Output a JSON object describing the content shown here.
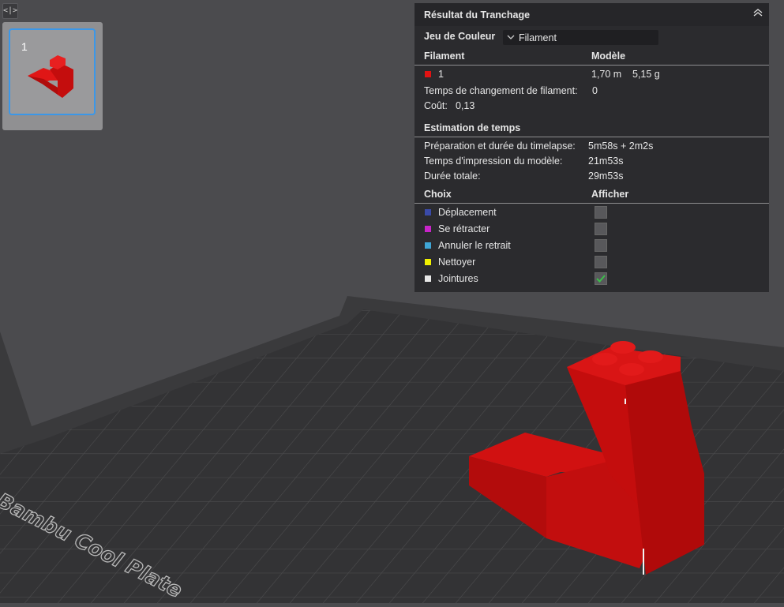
{
  "sidebar_toggle_label": "<|>",
  "plate_thumb": {
    "number": "1"
  },
  "result": {
    "title": "Résultat du Tranchage",
    "color_scheme_label": "Jeu de Couleur",
    "color_scheme_value": "Filament",
    "filament_header": "Filament",
    "model_header": "Modèle",
    "filament_rows": [
      {
        "swatch_color": "#e21212",
        "name": "1",
        "length": "1,70 m",
        "weight": "5,15 g"
      }
    ],
    "filament_change_label": "Temps de changement de filament:",
    "filament_change_value": "0",
    "cost_label": "Coût:",
    "cost_value": "0,13",
    "time_estimation_title": "Estimation de temps",
    "time_rows": [
      {
        "label": "Préparation et durée du timelapse:",
        "value": "5m58s + 2m2s"
      },
      {
        "label": "Temps d'impression du modèle:",
        "value": "21m53s"
      },
      {
        "label": "Durée totale:",
        "value": "29m53s"
      }
    ],
    "choice_header": "Choix",
    "show_header": "Afficher",
    "options": [
      {
        "label": "Déplacement",
        "color": "#3a4aa8",
        "checked": false
      },
      {
        "label": "Se rétracter",
        "color": "#c824c8",
        "checked": false
      },
      {
        "label": "Annuler le retrait",
        "color": "#3fa6d6",
        "checked": false
      },
      {
        "label": "Nettoyer",
        "color": "#f0f000",
        "checked": false
      },
      {
        "label": "Jointures",
        "color": "#e8e8e8",
        "checked": true
      }
    ]
  },
  "plate_label": "Bambu Cool Plate",
  "colors": {
    "model_red": "#c40d0d",
    "check_green": "#3bbf4a",
    "accent_blue": "#3b97e8"
  }
}
